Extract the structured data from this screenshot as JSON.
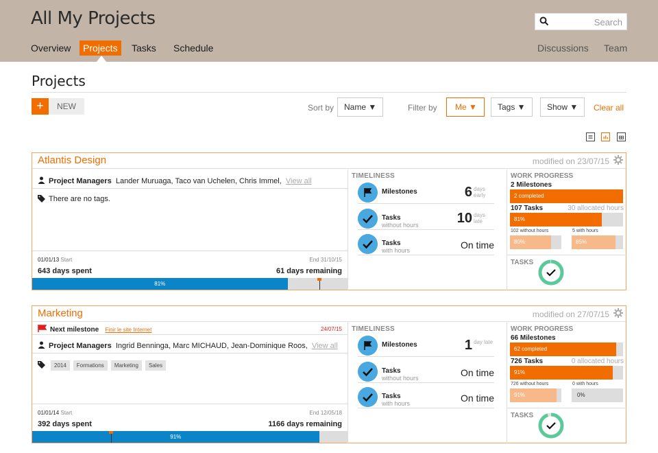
{
  "app": {
    "title": "All My Projects"
  },
  "search": {
    "placeholder": "Search"
  },
  "nav": {
    "overview": "Overview",
    "projects": "Projects",
    "tasks": "Tasks",
    "schedule": "Schedule",
    "discussions": "Discussions",
    "team": "Team"
  },
  "page": {
    "title": "Projects",
    "new_label": "NEW",
    "new_plus": "+"
  },
  "toolbar": {
    "sort_label": "Sort by",
    "sort_value": "Name ▼",
    "filter_label": "Filter by",
    "filter_me": "Me ▼",
    "filter_tags": "Tags ▼",
    "filter_show": "Show ▼",
    "clear_all": "Clear all"
  },
  "colors": {
    "accent": "#f26d00",
    "bar_blue": "#0b85c8",
    "circle_blue": "#4aa8e0",
    "ring_green": "#5cc99a"
  },
  "projects": [
    {
      "name": "Atlantis Design",
      "modified": "modified on 23/07/15",
      "managers_label": "Project Managers",
      "managers": "Lander Muruaga,   Taco van Uchelen,   Chris Immel,",
      "view_all": "View all",
      "tags_text": "There are no tags.",
      "start_date": "01/01/13",
      "start_word": "Start",
      "end_text": "End 31/10/15",
      "days_spent": "643 days spent",
      "days_remaining": "61 days remaining",
      "progress_text": "81%",
      "progress": 0.81,
      "marker": 0.91,
      "timeliness_title": "TIMELINESS",
      "tl": [
        {
          "name": "Milestones",
          "sub": "",
          "big": "6",
          "unit": "days early"
        },
        {
          "name": "Tasks",
          "sub": "without hours",
          "big": "10",
          "unit": "days late"
        },
        {
          "name": "Tasks",
          "sub": "with hours",
          "ontime": "On time"
        }
      ],
      "wp_title": "WORK PROGRESS",
      "milestones_count": "2 Milestones",
      "milestones_bar": "2 completed",
      "milestones_progress": 1.0,
      "tasks_count": "107 Tasks",
      "tasks_alloc": "30 allocated hours",
      "tasks_bar": "81%",
      "tasks_progress": 0.81,
      "mini_left_label": "102 without hours",
      "mini_left_value": "80%",
      "mini_left_progress": 0.8,
      "mini_right_label": "5 with hours",
      "mini_right_value": "85%",
      "mini_right_progress": 0.85,
      "tasks_label": "TASKS",
      "ring_progress": 0.99
    },
    {
      "name": "Marketing",
      "modified": "modified on 27/07/15",
      "next_milestone_label": "Next milestone",
      "next_milestone_link": "Finir le site Internet",
      "next_milestone_date": "24/07/15",
      "managers_label": "Project Managers",
      "managers": "Ingrid Benninga,   Marc MICHAUD,   Jean-Dominique Roos,",
      "view_all": "View all",
      "tags": [
        "2014",
        "Formations",
        "Marketing",
        "Sales"
      ],
      "start_date": "01/01/14",
      "start_word": "Start",
      "end_text": "End 12/05/18",
      "days_spent": "392 days spent",
      "days_remaining": "1166 days remaining",
      "progress_text": "91%",
      "progress": 0.91,
      "marker": 0.25,
      "timeliness_title": "TIMELINESS",
      "tl": [
        {
          "name": "Milestones",
          "sub": "",
          "big": "1",
          "unit": "day late"
        },
        {
          "name": "Tasks",
          "sub": "without hours",
          "ontime": "On time"
        },
        {
          "name": "Tasks",
          "sub": "with hours",
          "ontime": "On time"
        }
      ],
      "wp_title": "WORK PROGRESS",
      "milestones_count": "66 Milestones",
      "milestones_bar": "62 completed",
      "milestones_progress": 0.94,
      "tasks_count": "726 Tasks",
      "tasks_alloc": "0 allocated hours",
      "tasks_bar": "91%",
      "tasks_progress": 0.91,
      "mini_left_label": "726 without hours",
      "mini_left_value": "91%",
      "mini_left_progress": 0.91,
      "mini_right_label": "0 with hours",
      "mini_right_value": "0%",
      "mini_right_progress": 0.0,
      "tasks_label": "TASKS",
      "ring_progress": 0.95
    }
  ]
}
